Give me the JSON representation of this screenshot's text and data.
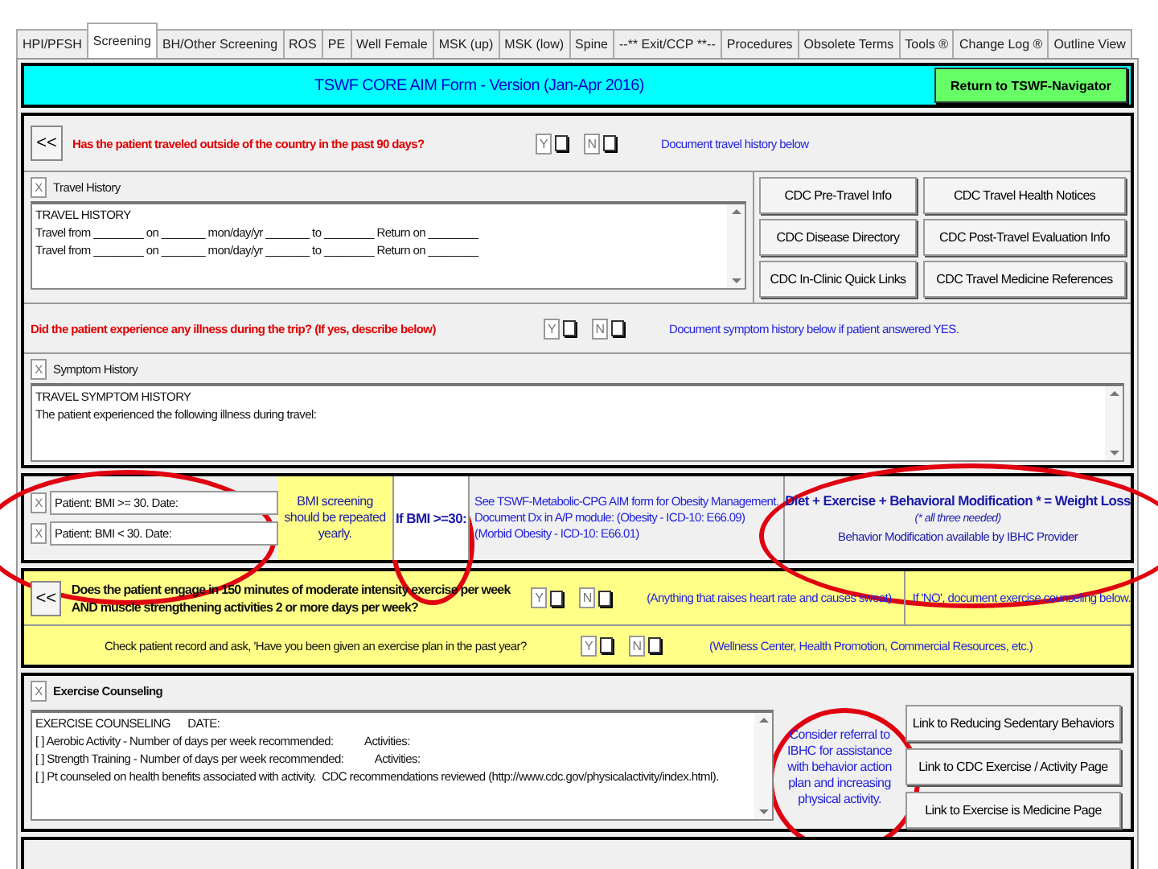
{
  "tabs": [
    {
      "label": "HPI/PFSH",
      "selected": false
    },
    {
      "label": "Screening",
      "selected": true
    },
    {
      "label": "BH/Other Screening",
      "selected": false
    },
    {
      "label": "ROS",
      "selected": false
    },
    {
      "label": "PE",
      "selected": false
    },
    {
      "label": "Well Female",
      "selected": false
    },
    {
      "label": "MSK (up)",
      "selected": false
    },
    {
      "label": "MSK (low)",
      "selected": false
    },
    {
      "label": "Spine",
      "selected": false
    },
    {
      "label": "--** Exit/CCP **--",
      "selected": false
    },
    {
      "label": "Procedures",
      "selected": false
    },
    {
      "label": "Obsolete Terms",
      "selected": false
    },
    {
      "label": "Tools ®",
      "selected": false
    },
    {
      "label": "Change Log ®",
      "selected": false
    },
    {
      "label": "Outline View",
      "selected": false
    }
  ],
  "header": {
    "title": "TSWF CORE AIM Form - Version (Jan-Apr 2016)",
    "nav_button": "Return to TSWF-Navigator"
  },
  "travel_question": {
    "back": "<<",
    "question": "Has the patient traveled outside of the country in the past 90 days?",
    "yes": "Y",
    "yes_checked": false,
    "no": "N",
    "no_checked": false,
    "note": "Document travel history below"
  },
  "travel_history": {
    "mark": "X",
    "checked": true,
    "label": "Travel History",
    "lines": [
      "TRAVEL HISTORY",
      "Travel from ________ on _______ mon/day/yr _______ to ________ Return on ________",
      "Travel from ________ on _______ mon/day/yr _______ to ________ Return on ________"
    ],
    "links": [
      "CDC Pre-Travel Info",
      "CDC Travel Health Notices",
      "CDC Disease Directory",
      "CDC Post-Travel Evaluation Info",
      "CDC In-Clinic Quick Links",
      "CDC Travel Medicine References"
    ]
  },
  "illness_question": {
    "question": "Did the patient experience any illness during the trip? (If yes, describe below)",
    "yes": "Y",
    "yes_checked": false,
    "no": "N",
    "no_checked": false,
    "note": "Document symptom history below if patient answered YES."
  },
  "symptom_history": {
    "mark": "X",
    "checked": true,
    "label": "Symptom History",
    "lines": [
      "TRAVEL SYMPTOM HISTORY",
      "The patient experienced the following illness during travel:"
    ]
  },
  "bmi": {
    "items": [
      {
        "mark": "X",
        "checked": true,
        "label": "Patient: BMI >= 30.  Date:"
      },
      {
        "mark": "X",
        "checked": true,
        "label": "Patient: BMI < 30.  Date:"
      }
    ],
    "screening_note": "BMI screening should be repeated yearly.",
    "if_label": "If BMI >=30:",
    "info_lines": [
      "See TSWF-Metabolic-CPG AIM form for Obesity Management.",
      "Document Dx in A/P module: (Obesity - ICD-10: E66.09)",
      "(Morbid Obesity - ICD-10: E66.01)"
    ],
    "formula": "Diet + Exercise + Behavioral Modification * = Weight Loss",
    "formula_note": "(* all three needed)",
    "provider_note": "Behavior Modification available by IBHC Provider"
  },
  "exercise_question": {
    "back": "<<",
    "lines": [
      "Does the patient engage in 150 minutes of moderate intensity exercise per week",
      "AND muscle strengthening activities 2 or more days per week?"
    ],
    "yes": "Y",
    "yes_checked": false,
    "no": "N",
    "no_checked": false,
    "note": "(Anything that raises heart rate and causes sweat)",
    "if_no": "If 'NO', document exercise counseling below."
  },
  "plan_question": {
    "question": "Check patient record and ask, 'Have you been given an exercise plan in the past year?",
    "yes": "Y",
    "yes_checked": false,
    "no": "N",
    "no_checked": false,
    "note": "(Wellness Center, Health Promotion, Commercial Resources, etc.)"
  },
  "exercise_counseling": {
    "mark": "X",
    "checked": true,
    "label": "Exercise Counseling",
    "lines": [
      "EXERCISE COUNSELING      DATE:",
      "[ ] Aerobic Activity - Number of days per week recommended:           Activities:",
      "[ ] Strength Training - Number of days per week recommended:           Activities:",
      "[ ] Pt counseled on health benefits associated with activity.  CDC recommendations reviewed (http://www.cdc.gov/physicalactivity/index.html)."
    ],
    "referral": "Consider referral to IBHC for assistance with behavior action plan and increasing physical activity.",
    "links": [
      "Link to Reducing Sedentary Behaviors",
      "Link to CDC Exercise / Activity Page",
      "Link to Exercise is Medicine Page"
    ]
  }
}
